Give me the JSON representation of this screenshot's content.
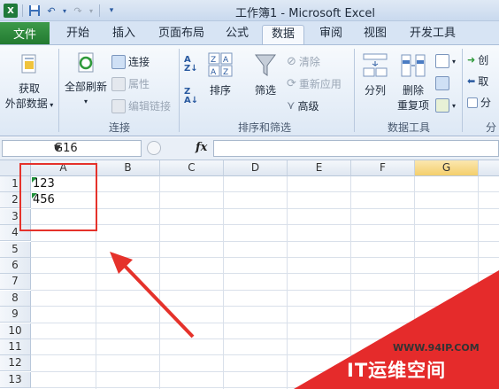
{
  "window": {
    "title": "工作簿1 - Microsoft Excel"
  },
  "ribbon_tabs": [
    {
      "label": "文件"
    },
    {
      "label": "开始"
    },
    {
      "label": "插入"
    },
    {
      "label": "页面布局"
    },
    {
      "label": "公式"
    },
    {
      "label": "数据"
    },
    {
      "label": "审阅"
    },
    {
      "label": "视图"
    },
    {
      "label": "开发工具"
    }
  ],
  "ribbon": {
    "get_external_data": {
      "line1": "获取",
      "line2": "外部数据"
    },
    "refresh_all": "全部刷新",
    "connections": "连接",
    "properties": "属性",
    "edit_links": "编辑链接",
    "group_connections": "连接",
    "sort": "排序",
    "filter": "筛选",
    "clear": "清除",
    "reapply": "重新应用",
    "advanced": "高级",
    "group_sort_filter": "排序和筛选",
    "text_to_columns": "分列",
    "remove_dup": {
      "line1": "删除",
      "line2": "重复项"
    },
    "group_data_tools": "数据工具",
    "outline_create": "创",
    "outline_cancel": "取",
    "outline_subtotal": "分",
    "group_outline": "分"
  },
  "formula_bar": {
    "name_box": "G16",
    "fx": "fx",
    "value": ""
  },
  "sheet": {
    "columns": [
      "A",
      "B",
      "C",
      "D",
      "E",
      "F",
      "G"
    ],
    "selected_column": "G",
    "rows": [
      "1",
      "2",
      "3",
      "4",
      "5",
      "6",
      "7",
      "8",
      "9",
      "10",
      "11",
      "12",
      "13"
    ],
    "cells": {
      "A1": "123",
      "A2": "456"
    }
  },
  "watermark": {
    "url": "WWW.94IP.COM",
    "brand": "IT运维空间"
  },
  "colors": {
    "file_tab": "#2f8a3c",
    "highlight_red": "#e5322b",
    "selected_header": "#f4cf6c"
  }
}
